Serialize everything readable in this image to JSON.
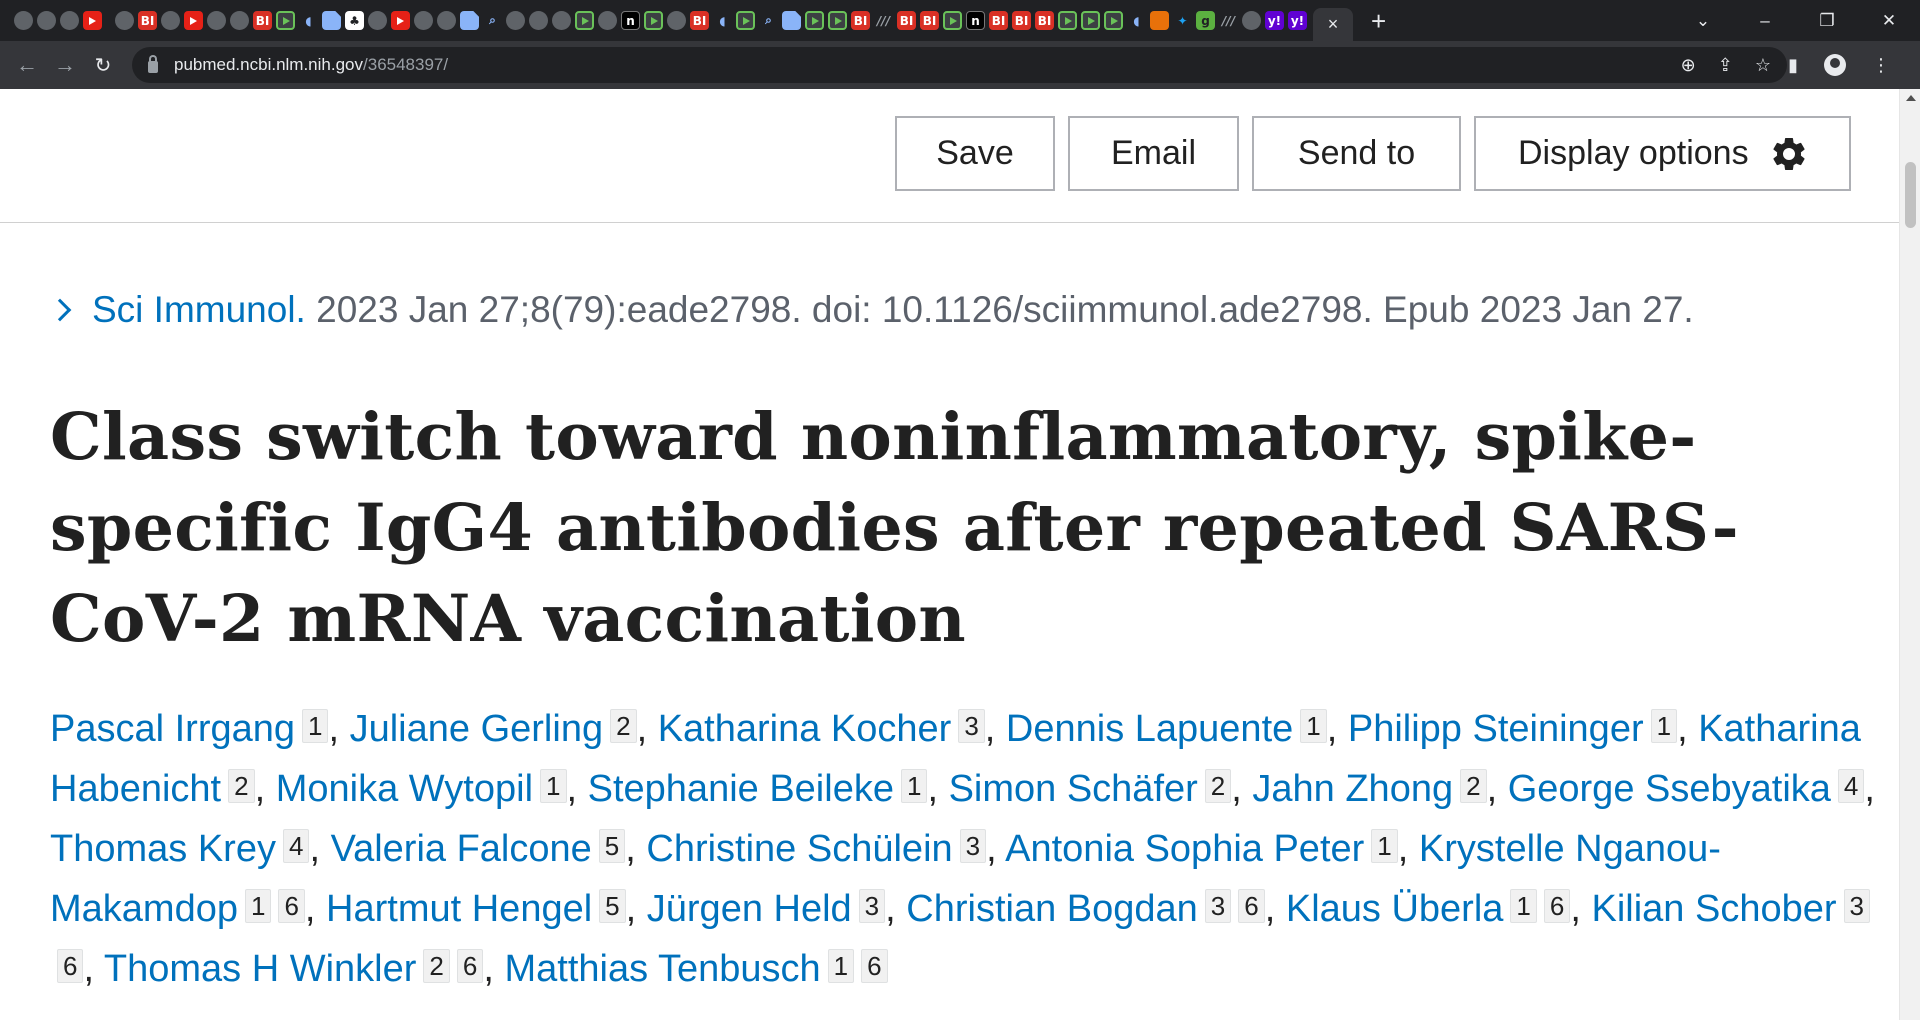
{
  "browser": {
    "tab_close": "×",
    "new_tab": "+",
    "window_controls": [
      "⌄",
      "–",
      "❐",
      "✕"
    ],
    "url_host": "pubmed.ncbi.nlm.nih.gov",
    "url_path": "/36548397/",
    "tab_icons": [
      "globe",
      "globe",
      "globe",
      "yt",
      "gap-globe",
      "bi",
      "globe",
      "yt",
      "globe",
      "globe",
      "bi",
      "play",
      "shield",
      "doc",
      "white",
      "globe",
      "yt",
      "globe",
      "globe",
      "doc",
      "search",
      "globe",
      "globe",
      "globe",
      "play",
      "globe",
      "n",
      "play",
      "globe",
      "bi",
      "shield",
      "play",
      "search",
      "doc",
      "play",
      "play",
      "bi",
      "fa",
      "bi",
      "bi",
      "play",
      "n",
      "bi",
      "bi",
      "bi",
      "play",
      "play",
      "play",
      "shield",
      "bm",
      "tw",
      "g",
      "fa",
      "globe",
      "yh",
      "yh"
    ]
  },
  "actions": {
    "save": "Save",
    "email": "Email",
    "send_to": "Send to",
    "display_options": "Display options"
  },
  "citation": {
    "journal": "Sci Immunol.",
    "details": "2023 Jan 27;8(79):eade2798. doi: 10.1126/sciimmunol.ade2798. Epub 2023 Jan 27."
  },
  "article": {
    "title": "Class switch toward noninflammatory, spike-specific IgG4 antibodies after repeated SARS-CoV-2 mRNA vaccination"
  },
  "authors": [
    {
      "name": "Pascal Irrgang",
      "aff": [
        "1"
      ]
    },
    {
      "name": "Juliane Gerling",
      "aff": [
        "2"
      ]
    },
    {
      "name": "Katharina Kocher",
      "aff": [
        "3"
      ]
    },
    {
      "name": "Dennis Lapuente",
      "aff": [
        "1"
      ]
    },
    {
      "name": "Philipp Steininger",
      "aff": [
        "1"
      ]
    },
    {
      "name": "Katharina Habenicht",
      "aff": [
        "2"
      ]
    },
    {
      "name": "Monika Wytopil",
      "aff": [
        "1"
      ]
    },
    {
      "name": "Stephanie Beileke",
      "aff": [
        "1"
      ]
    },
    {
      "name": "Simon Schäfer",
      "aff": [
        "2"
      ]
    },
    {
      "name": "Jahn Zhong",
      "aff": [
        "2"
      ]
    },
    {
      "name": "George Ssebyatika",
      "aff": [
        "4"
      ]
    },
    {
      "name": "Thomas Krey",
      "aff": [
        "4"
      ]
    },
    {
      "name": "Valeria Falcone",
      "aff": [
        "5"
      ]
    },
    {
      "name": "Christine Schülein",
      "aff": [
        "3"
      ]
    },
    {
      "name": "Antonia Sophia Peter",
      "aff": [
        "1"
      ]
    },
    {
      "name": "Krystelle Nganou-Makamdop",
      "aff": [
        "1",
        "6"
      ]
    },
    {
      "name": "Hartmut Hengel",
      "aff": [
        "5"
      ]
    },
    {
      "name": "Jürgen Held",
      "aff": [
        "3"
      ]
    },
    {
      "name": "Christian Bogdan",
      "aff": [
        "3",
        "6"
      ]
    },
    {
      "name": "Klaus Überla",
      "aff": [
        "1",
        "6"
      ]
    },
    {
      "name": "Kilian Schober",
      "aff": [
        "3",
        "6"
      ]
    },
    {
      "name": "Thomas H Winkler",
      "aff": [
        "2",
        "6"
      ]
    },
    {
      "name": "Matthias Tenbusch",
      "aff": [
        "1",
        "6"
      ]
    }
  ]
}
